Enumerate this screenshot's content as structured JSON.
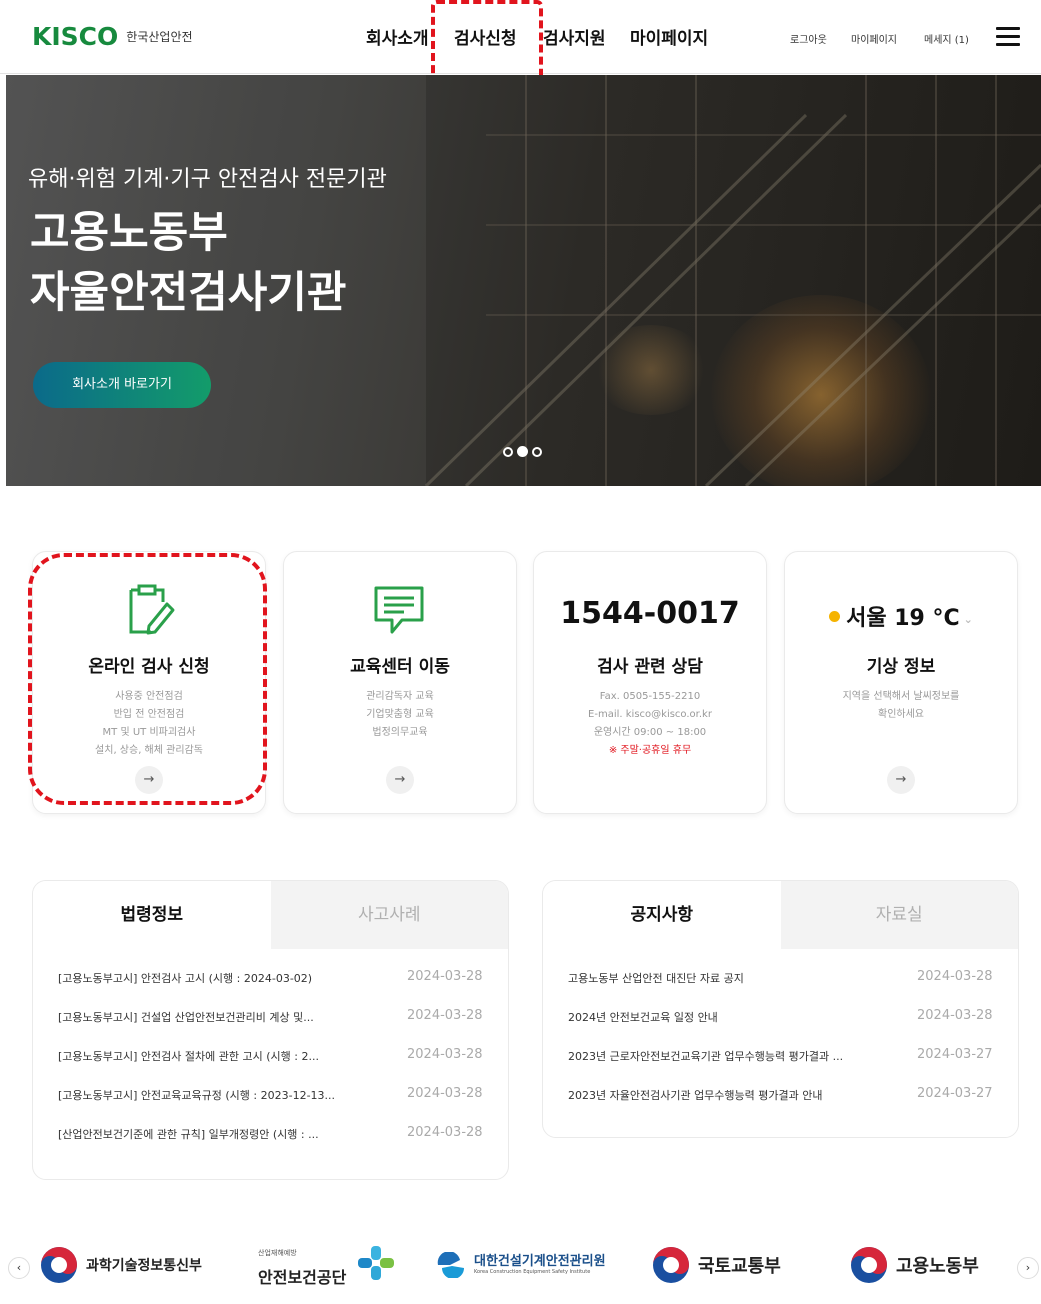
{
  "header": {
    "logo_mark": "KISCO",
    "logo_sub": "한국산업안전",
    "nav": [
      "회사소개",
      "검사신청",
      "검사지원",
      "마이페이지"
    ],
    "util": [
      "로그아웃",
      "마이페이지",
      "메세지 (1)"
    ]
  },
  "hero": {
    "kicker": "유해·위험 기계·기구 안전검사 전문기관",
    "title_line1": "고용노동부",
    "title_line2": "자율안전검사기관",
    "button": "회사소개 바로가기",
    "slides_total": 3,
    "slide_active": 2
  },
  "cards": [
    {
      "title": "온라인 검사 신청",
      "desc": [
        "사용중 안전점검",
        "반입 전 안전점검",
        "MT 및 UT 비파괴검사",
        "설치, 상승, 해체 관리감독"
      ]
    },
    {
      "title": "교육센터 이동",
      "desc": [
        "관리감독자 교육",
        "기업맞춤형 교육",
        "법정의무교육"
      ]
    },
    {
      "phone": "1544-0017",
      "title": "검사 관련 상담",
      "desc": [
        "Fax. 0505-155-2210",
        "E-mail. kisco@kisco.or.kr",
        "운영시간 09:00 ~ 18:00"
      ],
      "note": "※ 주말·공휴일 휴무"
    },
    {
      "weather": "서울 19 °C",
      "title": "기상 정보",
      "desc": [
        "지역을 선택해서 날씨정보를",
        "확인하세요"
      ]
    }
  ],
  "boards": [
    {
      "tabs": [
        "법령정보",
        "사고사례"
      ],
      "active_tab": 0,
      "rows": [
        {
          "title": "[고용노동부고시] 안전검사 고시 (시행 : 2024-03-02)",
          "date": "2024-03-28"
        },
        {
          "title": "[고용노동부고시] 건설업 산업안전보건관리비 계상 및...",
          "date": "2024-03-28"
        },
        {
          "title": "[고용노동부고시] 안전검사 절차에 관한 고시 (시행 : 2...",
          "date": "2024-03-28"
        },
        {
          "title": "[고용노동부고시] 안전교육교육규정 (시행 : 2023-12-13...",
          "date": "2024-03-28"
        },
        {
          "title": "[산업안전보건기준에 관한 규칙] 일부개정령안 (시행 : ...",
          "date": "2024-03-28"
        }
      ]
    },
    {
      "tabs": [
        "공지사항",
        "자료실"
      ],
      "active_tab": 0,
      "rows": [
        {
          "title": "고용노동부 산업안전 대진단 자료 공지",
          "date": "2024-03-28"
        },
        {
          "title": "2024년 안전보건교육 일정 안내",
          "date": "2024-03-28"
        },
        {
          "title": "2023년 근로자안전보건교육기관 업무수행능력 평가결과 ...",
          "date": "2024-03-27"
        },
        {
          "title": "2023년 자율안전검사기관 업무수행능력 평가결과 안내",
          "date": "2024-03-27"
        }
      ]
    }
  ],
  "partners": {
    "prev": "‹",
    "next": "›",
    "items": [
      "과학기술정보통신부",
      "안전보건공단",
      "대한건설기계안전관리원",
      "국토교통부",
      "고용노동부"
    ],
    "kosha_small": "산업재해예방",
    "kcesi_small": "Korea Construction Equipment Safety Institute"
  },
  "colors": {
    "brand_green": "#178a3e",
    "accent_red": "#e1141d",
    "hero_button_start": "#0b6a8a",
    "hero_button_end": "#139c6a"
  }
}
